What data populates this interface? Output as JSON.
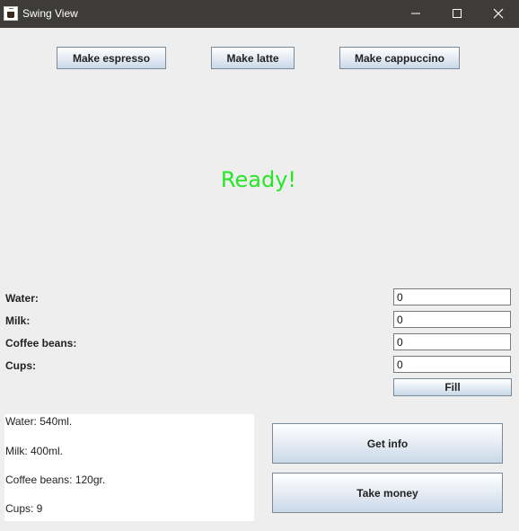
{
  "window": {
    "title": "Swing View",
    "icons": {
      "app": "coffee-app-icon",
      "minimize": "minimize-icon",
      "maximize": "maximize-icon",
      "close": "close-icon"
    }
  },
  "actions": {
    "espresso": "Make espresso",
    "latte": "Make latte",
    "cappuccino": "Make cappuccino"
  },
  "status": {
    "text": "Ready!",
    "color": "#26e626"
  },
  "fill_form": {
    "water_label": "Water:",
    "milk_label": "Milk:",
    "beans_label": "Coffee beans:",
    "cups_label": "Cups:",
    "water_value": "0",
    "milk_value": "0",
    "beans_value": "0",
    "cups_value": "0",
    "fill_button": "Fill"
  },
  "info": {
    "water": "Water: 540ml.",
    "milk": "Milk: 400ml.",
    "beans": "Coffee beans: 120gr.",
    "cups": "Cups: 9"
  },
  "side_buttons": {
    "get_info": "Get info",
    "take_money": "Take money"
  }
}
